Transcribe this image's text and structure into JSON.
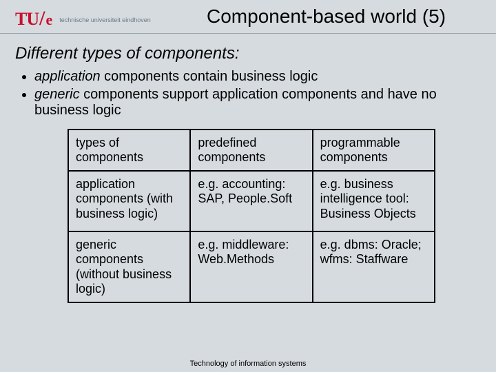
{
  "logo": {
    "tu": "TU",
    "slash": "/",
    "e": "e",
    "subtitle": "technische universiteit eindhoven"
  },
  "title": "Component-based world (5)",
  "subtitle": "Different types of components:",
  "bullets": [
    {
      "em": "application",
      "rest": " components contain business logic"
    },
    {
      "em": "generic",
      "rest": " components support application components and have no business logic"
    }
  ],
  "table": {
    "r0c0": "types of components",
    "r0c1": "predefined components",
    "r0c2": "programmable components",
    "r1c0": "application components (with business logic)",
    "r1c1": "e.g. accounting: SAP, People.Soft",
    "r1c2": "e.g. business intelligence tool: Business Objects",
    "r2c0": "generic components (without business logic)",
    "r2c1": "e.g. middleware: Web.Methods",
    "r2c2": "e.g. dbms: Oracle; wfms: Staffware"
  },
  "footer": "Technology of  information systems"
}
